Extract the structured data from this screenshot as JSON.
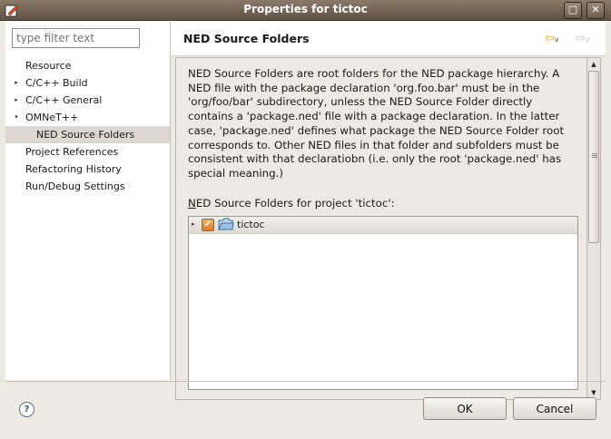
{
  "window": {
    "title": "Properties for tictoc",
    "maximize_glyph": "□",
    "close_glyph": "✕"
  },
  "sidebar": {
    "filter_placeholder": "type filter text",
    "items": [
      {
        "label": "Resource",
        "arrow": "",
        "indent": 0
      },
      {
        "label": "C/C++ Build",
        "arrow": "▸",
        "indent": 0
      },
      {
        "label": "C/C++ General",
        "arrow": "▸",
        "indent": 0
      },
      {
        "label": "OMNeT++",
        "arrow": "▾",
        "indent": 0
      },
      {
        "label": "NED Source Folders",
        "arrow": "",
        "indent": 1,
        "selected": true
      },
      {
        "label": "Project References",
        "arrow": "",
        "indent": 0
      },
      {
        "label": "Refactoring History",
        "arrow": "",
        "indent": 0
      },
      {
        "label": "Run/Debug Settings",
        "arrow": "",
        "indent": 0
      }
    ]
  },
  "page": {
    "title": "NED Source Folders",
    "back_glyph": "⇦",
    "forward_glyph": "⇨",
    "dropdown_glyph": "v",
    "description": "NED Source Folders are root folders for the NED package hierarchy. A NED file with the package declaration 'org.foo.bar' must be in the 'org/foo/bar' subdirectory, unless the NED Source Folder directly contains a 'package.ned' file with a package declaration. In the latter case, 'package.ned' defines what package the NED Source Folder root corresponds to. Other NED files in that folder and subfolders must be consistent with that declaratiobn (i.e. only the root 'package.ned' has special meaning.)",
    "list_label_mnemonic": "N",
    "list_label_rest": "ED Source Folders for project 'tictoc':",
    "folders": [
      {
        "label": "tictoc",
        "checked": true,
        "expander": "▸",
        "check_glyph": "✔"
      }
    ]
  },
  "scrollbar": {
    "up_glyph": "▲",
    "down_glyph": "▼"
  },
  "footer": {
    "help_glyph": "?",
    "ok_label": "OK",
    "cancel_label": "Cancel"
  },
  "colors": {
    "accent_checkbox": "#e8862c",
    "titlebar": "#6f6053",
    "selection": "#dcd8d1"
  }
}
